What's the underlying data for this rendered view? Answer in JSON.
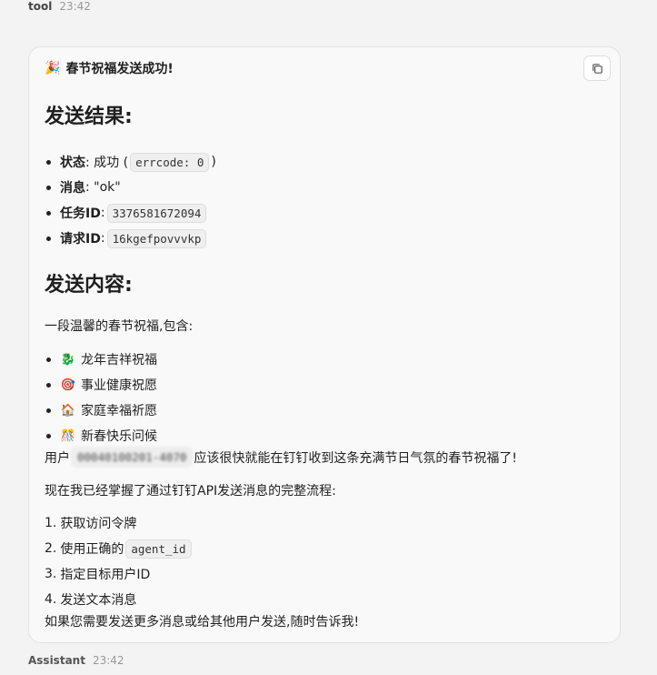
{
  "header": {
    "sender": "tool",
    "time": "23:42"
  },
  "card": {
    "title_icon": "party-popper-icon",
    "title_emoji": "🎉",
    "title": "春节祝福发送成功!",
    "result_heading": "发送结果:",
    "result_items": [
      {
        "key": "状态",
        "sep": ": 成功 (",
        "code": "errcode: 0",
        "after": ")"
      },
      {
        "key": "消息",
        "sep": ": \"ok\"",
        "code": "",
        "after": ""
      },
      {
        "key": "任务ID",
        "sep": ": ",
        "code": "3376581672094",
        "after": ""
      },
      {
        "key": "请求ID",
        "sep": ": ",
        "code": "16kgefpovvvkp",
        "after": ""
      }
    ],
    "content_heading": "发送内容:",
    "intro": "一段温馨的春节祝福,包含:",
    "wishes": [
      {
        "icon": "dragon-icon",
        "emoji": "🐉",
        "text": "龙年吉祥祝福"
      },
      {
        "icon": "target-icon",
        "emoji": "🎯",
        "text": "事业健康祝愿"
      },
      {
        "icon": "house-icon",
        "emoji": "🏠",
        "text": "家庭幸福祈愿"
      },
      {
        "icon": "celebration-icon",
        "emoji": "🎊",
        "text": "新春快乐问候"
      }
    ],
    "user_prefix": "用户",
    "user_id": "00040100201-4070",
    "user_suffix": "应该很快就能在钉钉收到这条充满节日气氛的春节祝福了!",
    "now_text": "现在我已经掌握了通过钉钉API发送消息的完整流程:",
    "steps": [
      {
        "num": "1.",
        "text": "获取访问令牌",
        "code": ""
      },
      {
        "num": "2.",
        "text": "使用正确的",
        "code": "agent_id"
      },
      {
        "num": "3.",
        "text": "指定目标用户ID",
        "code": ""
      },
      {
        "num": "4.",
        "text": "发送文本消息",
        "code": ""
      }
    ],
    "final": "如果您需要发送更多消息或给其他用户发送,随时告诉我!"
  },
  "footer": {
    "sender": "Assistant",
    "time": "23:42"
  }
}
